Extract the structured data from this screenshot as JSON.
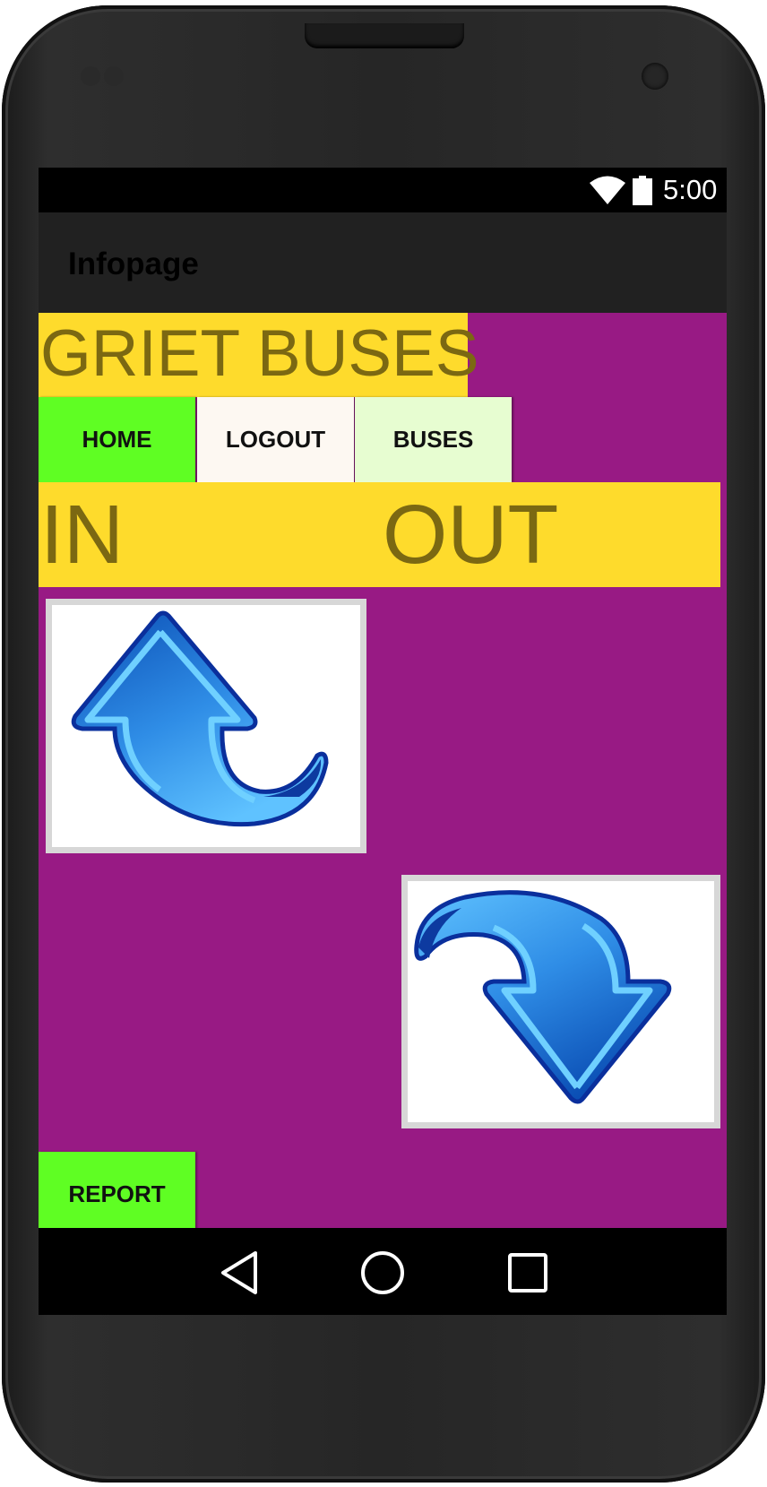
{
  "status_bar": {
    "time": "5:00",
    "icons": [
      "wifi-icon",
      "battery-icon"
    ]
  },
  "app_bar": {
    "title": "Infopage"
  },
  "banner": {
    "text": "GRIET BUSES"
  },
  "nav_buttons": {
    "home": "HOME",
    "logout": "LOGOUT",
    "buses": "BUSES"
  },
  "direction_labels": {
    "in": "IN",
    "out": "OUT"
  },
  "image_buttons": {
    "in_icon": "curved-arrow-up-icon",
    "out_icon": "curved-arrow-down-icon"
  },
  "report_button": "REPORT",
  "colors": {
    "background": "#981a84",
    "banner": "#fedb2c",
    "banner_text": "#7b6812",
    "home_button": "#5ffe23",
    "logout_button": "#fdf8f2",
    "buses_button": "#e7fdd1",
    "app_bar": "#212121"
  },
  "system_nav": [
    "back-icon",
    "home-icon",
    "recents-icon"
  ]
}
